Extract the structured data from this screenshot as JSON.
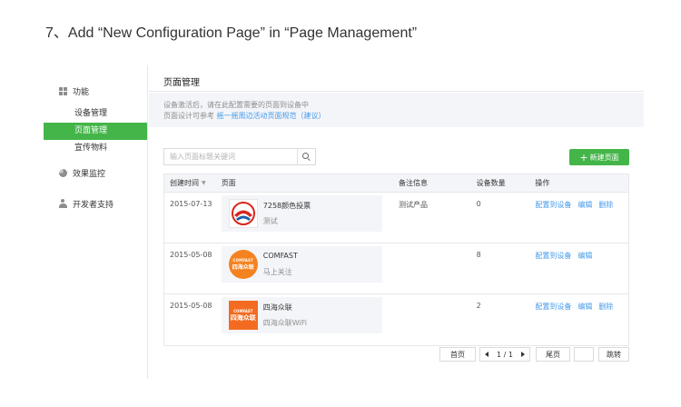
{
  "step_title": "7、Add “New Configuration Page” in “Page Management”",
  "sidebar": {
    "groups": [
      {
        "label": "功能",
        "icon": "grid-icon",
        "items": [
          {
            "label": "设备管理",
            "active": false
          },
          {
            "label": "页面管理",
            "active": true
          },
          {
            "label": "宣传物料",
            "active": false
          }
        ]
      },
      {
        "label": "效果监控",
        "icon": "pie-chart-icon"
      },
      {
        "label": "开发者支持",
        "icon": "user-icon"
      }
    ]
  },
  "main": {
    "title": "页面管理",
    "notice": {
      "line1": "设备激活后，请在此配置需要的页面到设备中",
      "line2_prefix": "页面设计可参考",
      "line2_link": "摇一摇周边活动页面规范（建议）"
    },
    "search": {
      "placeholder": "输入页面标题关键词",
      "value": ""
    },
    "create_button": {
      "plus": "+",
      "label": "新建页面"
    },
    "table": {
      "headers": {
        "date": "创建时间",
        "page": "页面",
        "note": "备注信息",
        "count": "设备数量",
        "ops": "操作"
      },
      "rows": [
        {
          "date": "2015-07-13",
          "name": "7258颜色投票",
          "desc": "测试",
          "note": "测试产品",
          "count": "0",
          "ops": [
            "配置到设备",
            "编辑",
            "删除"
          ],
          "thumb": "red-logo"
        },
        {
          "date": "2015-05-08",
          "name": "COMFAST",
          "desc": "马上关注",
          "note": "",
          "count": "8",
          "ops": [
            "配置到设备",
            "编辑"
          ],
          "thumb": "orange-circle-logo",
          "thumb_text1": "COMFAST",
          "thumb_text2": "四海众联"
        },
        {
          "date": "2015-05-08",
          "name": "四海众联",
          "desc": "四海众联WiFi",
          "note": "",
          "count": "2",
          "ops": [
            "配置到设备",
            "编辑",
            "删除"
          ],
          "thumb": "orange-square-logo",
          "thumb_text1": "COMFAST",
          "thumb_text2": "四海众联"
        }
      ]
    },
    "pagination": {
      "first": "首页",
      "current": "1 / 1",
      "last": "尾页",
      "jump": "跳转",
      "page_input": ""
    }
  },
  "colors": {
    "accent": "#44b549",
    "link": "#459ae9",
    "logo_orange": "#f58220",
    "logo_red": "#d7261f"
  }
}
